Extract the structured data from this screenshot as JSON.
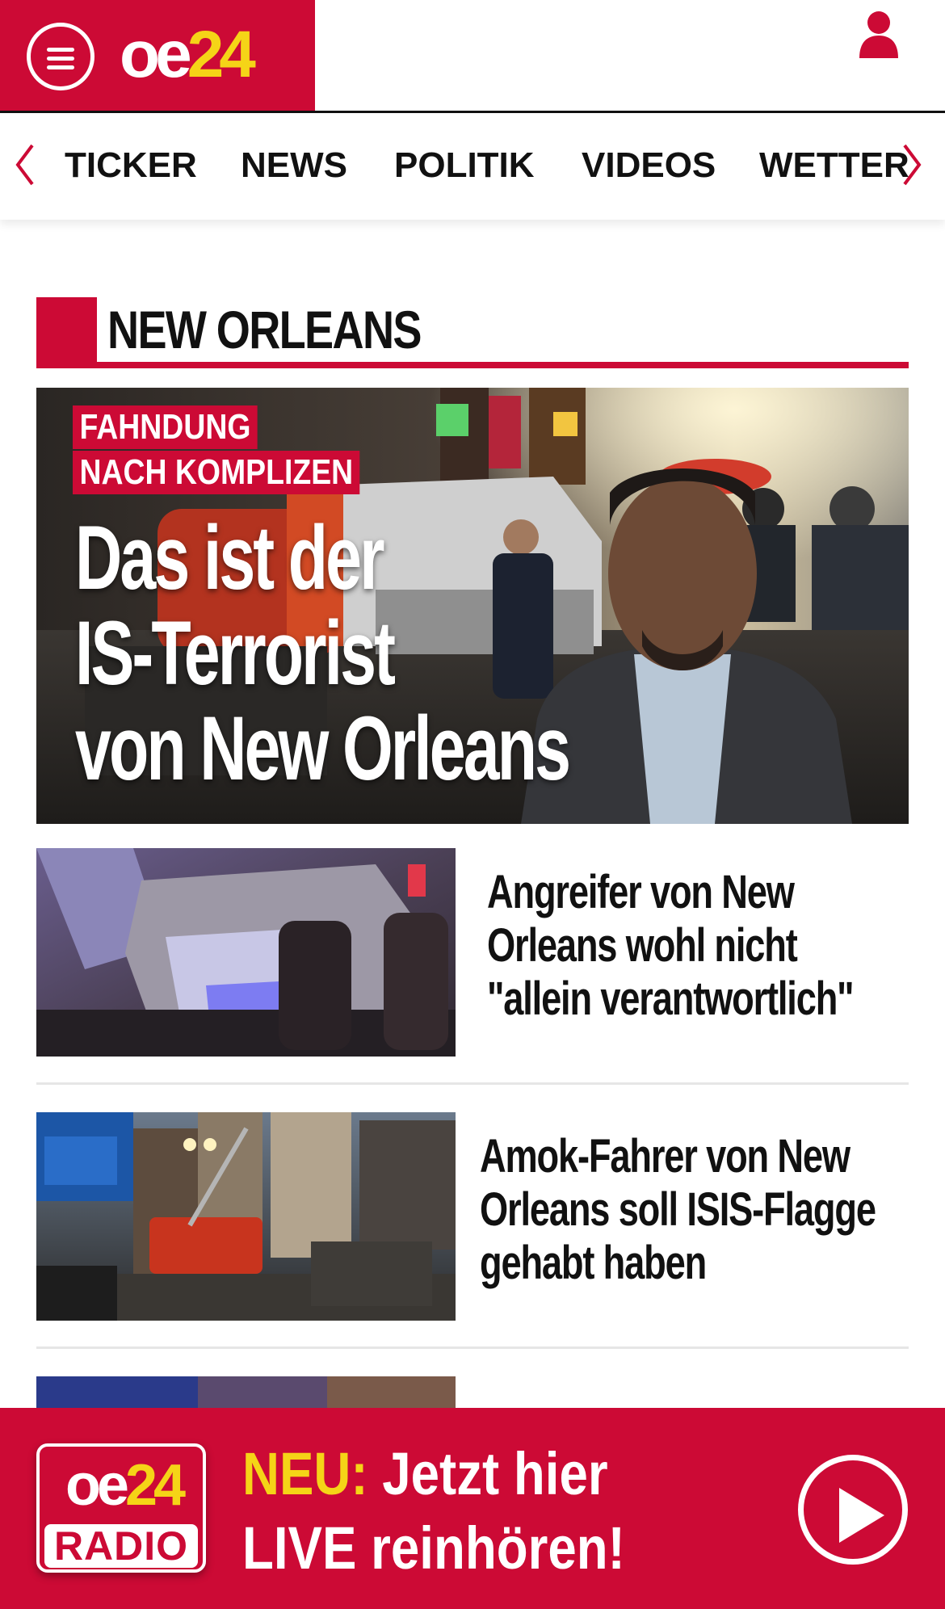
{
  "header": {
    "logo_oe": "oe",
    "logo_num": "24",
    "menu_icon": "hamburger-menu-icon",
    "user_icon": "user-icon"
  },
  "nav": {
    "items": [
      "TICKER",
      "NEWS",
      "POLITIK",
      "VIDEOS",
      "WETTER"
    ],
    "left_arrow_icon": "chevron-left-icon",
    "right_arrow_icon": "chevron-right-icon"
  },
  "section": {
    "title": "NEW ORLEANS"
  },
  "hero": {
    "label_line1": "FAHNDUNG",
    "label_line2": "NACH KOMPLIZEN",
    "title_line1": "Das ist der",
    "title_line2": "IS-Terrorist",
    "title_line3": "von New Orleans"
  },
  "articles": [
    {
      "lines": [
        "Angreifer von New",
        "Orleans wohl nicht",
        "\"allein verantwortlich\""
      ]
    },
    {
      "lines": [
        "Amok-Fahrer von New",
        "Orleans soll ISIS-Flagge",
        "gehabt haben"
      ]
    }
  ],
  "radio": {
    "logo_oe": "oe",
    "logo_num": "24",
    "logo_label": "RADIO",
    "accent": "NEU:",
    "line1_rest": " Jetzt hier",
    "line2": "LIVE reinhören!",
    "play_icon": "play-icon"
  },
  "colors": {
    "brand_red": "#cc0a35",
    "brand_yellow": "#f5d417"
  }
}
